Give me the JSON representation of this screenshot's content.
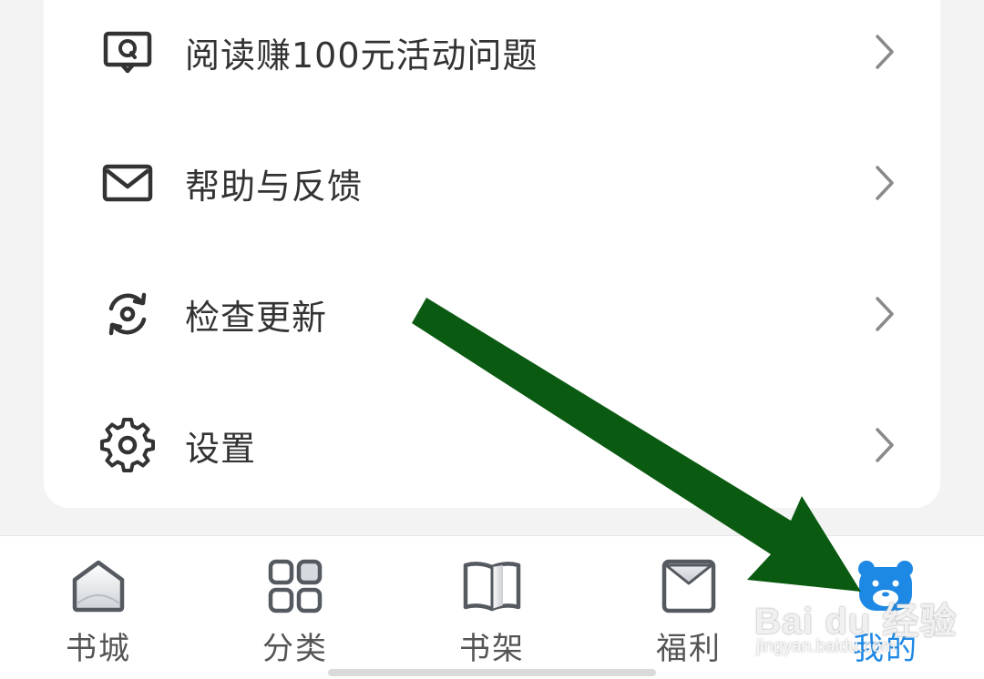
{
  "menu": {
    "items": [
      {
        "label": "阅读赚100元活动问题",
        "icon": "question-chat-icon"
      },
      {
        "label": "帮助与反馈",
        "icon": "mail-icon"
      },
      {
        "label": "检查更新",
        "icon": "refresh-icon"
      },
      {
        "label": "设置",
        "icon": "gear-icon"
      }
    ]
  },
  "tabbar": {
    "tabs": [
      {
        "label": "书城",
        "icon": "home-icon",
        "active": false
      },
      {
        "label": "分类",
        "icon": "grid-icon",
        "active": false
      },
      {
        "label": "书架",
        "icon": "book-icon",
        "active": false
      },
      {
        "label": "福利",
        "icon": "envelope-icon",
        "active": false
      },
      {
        "label": "我的",
        "icon": "bear-face-icon",
        "active": true
      }
    ]
  },
  "watermark": {
    "main": "Bai du 经验",
    "sub": "jingyan.baidu.com"
  },
  "colors": {
    "accent": "#1e88e5",
    "annotation_arrow": "#0b5a12",
    "icon": "#333333",
    "chevron": "#8a8a8a"
  }
}
